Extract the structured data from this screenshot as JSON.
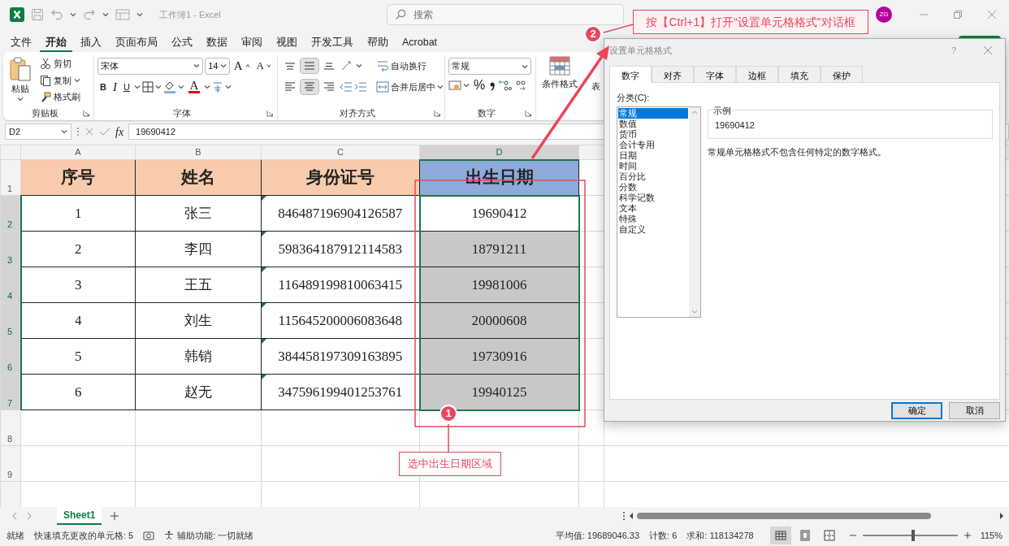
{
  "title_bar": {
    "title": "工作簿1 - Excel",
    "search_placeholder": "搜索",
    "avatar": "ZG"
  },
  "menu_tabs": [
    {
      "label": "文件",
      "selected": false
    },
    {
      "label": "开始",
      "selected": true
    },
    {
      "label": "插入",
      "selected": false
    },
    {
      "label": "页面布局",
      "selected": false
    },
    {
      "label": "公式",
      "selected": false
    },
    {
      "label": "数据",
      "selected": false
    },
    {
      "label": "审阅",
      "selected": false
    },
    {
      "label": "视图",
      "selected": false
    },
    {
      "label": "开发工具",
      "selected": false
    },
    {
      "label": "帮助",
      "selected": false
    },
    {
      "label": "Acrobat",
      "selected": false
    }
  ],
  "ribbon": {
    "clipboard": {
      "label": "剪贴板",
      "paste": "粘贴",
      "cut": "剪切",
      "copy": "复制",
      "format_painter": "格式刷"
    },
    "font": {
      "label": "字体",
      "font_name": "宋体",
      "font_size": "14",
      "grow_font": "A",
      "shrink_font": "A",
      "bold": "B",
      "italic": "I",
      "underline": "U",
      "font_color": "A"
    },
    "alignment": {
      "label": "对齐方式",
      "wrap_text": "自动换行",
      "merge_center": "合并后居中",
      "vertical": [
        {
          "selected": false
        },
        {
          "selected": true
        },
        {
          "selected": false
        }
      ],
      "horizontal": [
        {
          "selected": false
        },
        {
          "selected": true
        },
        {
          "selected": false
        }
      ]
    },
    "number": {
      "label": "数字",
      "format": "常规",
      "percent": "%"
    },
    "styles": {
      "conditional_formatting": "条件格式",
      "table_format": "表"
    }
  },
  "formula_bar": {
    "name_box": "D2",
    "fx": "fx",
    "formula": "19690412"
  },
  "sheet": {
    "column_headers": [
      {
        "label": "A",
        "selected": false
      },
      {
        "label": "B",
        "selected": false
      },
      {
        "label": "C",
        "selected": false
      },
      {
        "label": "D",
        "selected": true
      }
    ],
    "rows": [
      {
        "number": "1",
        "kind": "header",
        "cells": [
          {
            "text": "序号",
            "color": "#f8cbad"
          },
          {
            "text": "姓名",
            "color": "#f8cbad"
          },
          {
            "text": "身份证号",
            "color": "#f8cbad"
          },
          {
            "text": "出生日期",
            "color": "#8eaadb"
          }
        ]
      },
      {
        "number": "2",
        "kind": "data",
        "selected": true,
        "active": true,
        "flagged": true,
        "cells": [
          "1",
          "张三",
          "846487196904126587",
          "19690412"
        ]
      },
      {
        "number": "3",
        "kind": "data",
        "selected": true,
        "active": false,
        "flagged": true,
        "cells": [
          "2",
          "李四",
          "598364187912114583",
          "18791211"
        ]
      },
      {
        "number": "4",
        "kind": "data",
        "selected": true,
        "active": false,
        "flagged": true,
        "cells": [
          "3",
          "王五",
          "116489199810063415",
          "19981006"
        ]
      },
      {
        "number": "5",
        "kind": "data",
        "selected": true,
        "active": false,
        "flagged": true,
        "cells": [
          "4",
          "刘生",
          "115645200006083648",
          "20000608"
        ]
      },
      {
        "number": "6",
        "kind": "data",
        "selected": true,
        "active": false,
        "flagged": true,
        "cells": [
          "5",
          "韩销",
          "384458197309163895",
          "19730916"
        ]
      },
      {
        "number": "7",
        "kind": "data",
        "selected": true,
        "active": false,
        "flagged": true,
        "cells": [
          "6",
          "赵无",
          "347596199401253761",
          "19940125"
        ]
      },
      {
        "number": "8",
        "kind": "empty"
      },
      {
        "number": "9",
        "kind": "empty"
      }
    ]
  },
  "sheet_tabs": [
    {
      "label": "Sheet1",
      "selected": true
    }
  ],
  "status_bar": {
    "mode": "就绪",
    "flash_fill": "快速填充更改的单元格: 5",
    "accessibility": "辅助功能: 一切就绪",
    "average": "平均值: 19689046.33",
    "count": "计数: 6",
    "sum": "求和: 118134278",
    "views": [
      {
        "kind": "normal",
        "selected": true
      },
      {
        "kind": "page_layout",
        "selected": false
      },
      {
        "kind": "page_break",
        "selected": false
      }
    ],
    "zoom_level": {
      "level": 0.53
    },
    "zoom": "115%"
  },
  "dialog": {
    "title": "设置单元格格式",
    "help": "?",
    "tabs": [
      {
        "label": "数字",
        "selected": true
      },
      {
        "label": "对齐",
        "selected": false
      },
      {
        "label": "字体",
        "selected": false
      },
      {
        "label": "边框",
        "selected": false
      },
      {
        "label": "填充",
        "selected": false
      },
      {
        "label": "保护",
        "selected": false
      }
    ],
    "category_label": "分类(C):",
    "categories": [
      {
        "label": "常规",
        "selected": true
      },
      {
        "label": "数值",
        "selected": false
      },
      {
        "label": "货币",
        "selected": false
      },
      {
        "label": "会计专用",
        "selected": false
      },
      {
        "label": "日期",
        "selected": false
      },
      {
        "label": "时间",
        "selected": false
      },
      {
        "label": "百分比",
        "selected": false
      },
      {
        "label": "分数",
        "selected": false
      },
      {
        "label": "科学记数",
        "selected": false
      },
      {
        "label": "文本",
        "selected": false
      },
      {
        "label": "特殊",
        "selected": false
      },
      {
        "label": "自定义",
        "selected": false
      }
    ],
    "sample_label": "示例",
    "sample_value": "19690412",
    "description": "常规单元格格式不包含任何特定的数字格式。",
    "buttons": [
      {
        "label": "确定",
        "kind": "primary"
      },
      {
        "label": "取消",
        "kind": "default"
      }
    ]
  },
  "annotations": [
    {
      "number": "1",
      "text": "选中出生日期区域"
    },
    {
      "number": "2",
      "text": "按【Ctrl+1】打开“设置单元格格式”对话框"
    }
  ]
}
